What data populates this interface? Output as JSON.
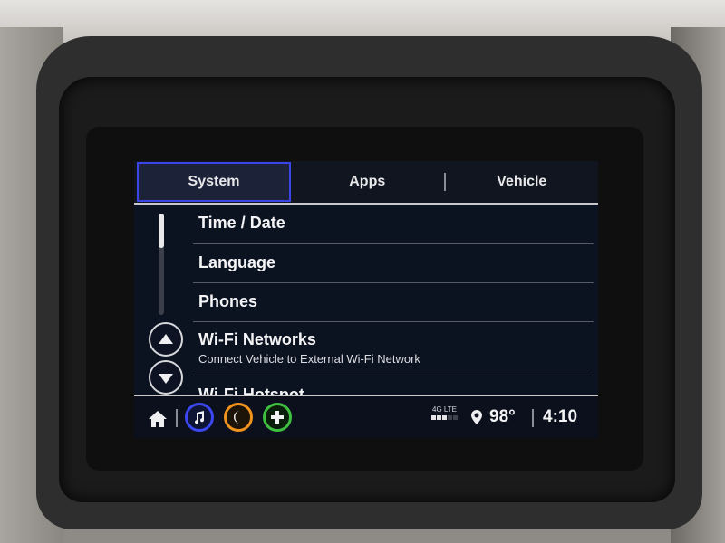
{
  "tabs": [
    {
      "label": "System",
      "active": true
    },
    {
      "label": "Apps",
      "active": false
    },
    {
      "label": "Vehicle",
      "active": false
    }
  ],
  "settings_list": [
    {
      "title": "Time / Date",
      "subtitle": ""
    },
    {
      "title": "Language",
      "subtitle": ""
    },
    {
      "title": "Phones",
      "subtitle": ""
    },
    {
      "title": "Wi-Fi Networks",
      "subtitle": "Connect Vehicle to External Wi-Fi Network"
    },
    {
      "title": "Wi-Fi Hotspot",
      "subtitle": ""
    }
  ],
  "scroll_controls": {
    "up_icon": "arrow-up-icon",
    "down_icon": "arrow-down-icon"
  },
  "bottom_bar": {
    "home_icon": "home-icon",
    "apps": [
      {
        "icon": "music-icon",
        "color": "#3b47f0"
      },
      {
        "icon": "phone-icon",
        "color": "#f0921e"
      },
      {
        "icon": "onstar-icon",
        "color": "#3fbf3f"
      }
    ],
    "network": "4G LTE",
    "signal_bars": 3,
    "signal_max": 5,
    "location_icon": "location-pin-icon",
    "temperature": "98°",
    "time": "4:10"
  },
  "colors": {
    "active_tab_border": "#3c46e8",
    "screen_bg": "#0b1220"
  }
}
